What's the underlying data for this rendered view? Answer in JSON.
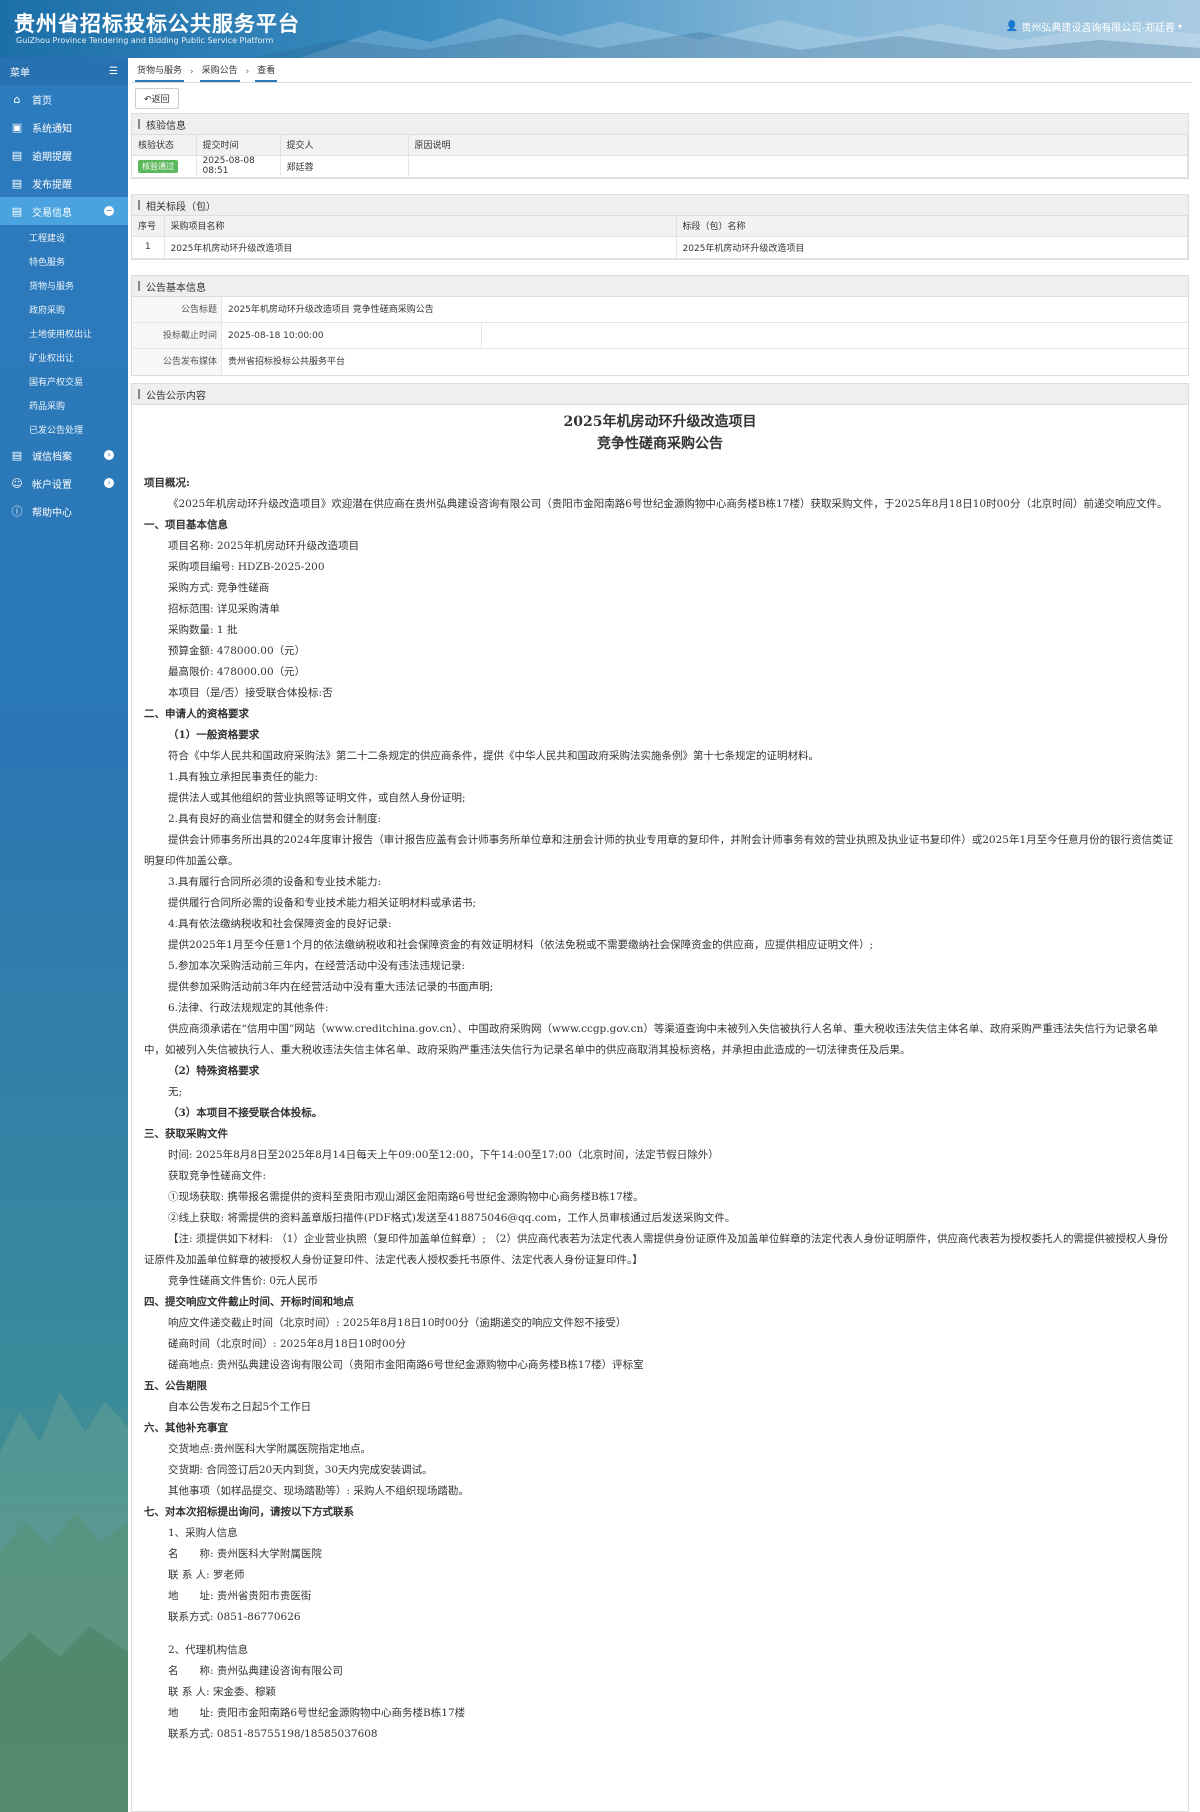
{
  "header": {
    "title": "贵州省招标投标公共服务平台",
    "subtitle": "GuiZhou Province Tendering and Bidding Public Service Platform",
    "user": "贵州弘典建设咨询有限公司-郑廷蓉"
  },
  "sidebar": {
    "menu_label": "菜单",
    "items": [
      {
        "label": "首页",
        "icon": "home-icon"
      },
      {
        "label": "系统通知",
        "icon": "monitor-icon"
      },
      {
        "label": "逾期提醒",
        "icon": "list-icon"
      },
      {
        "label": "发布提醒",
        "icon": "list-icon"
      },
      {
        "label": "交易信息",
        "icon": "list-icon"
      }
    ],
    "sub_items": [
      "工程建设",
      "特色服务",
      "货物与服务",
      "政府采购",
      "土地使用权出让",
      "矿业权出让",
      "国有产权交易",
      "药品采购",
      "已发公告处理"
    ],
    "bottom_items": [
      {
        "label": "诚信档案",
        "icon": "list-icon"
      },
      {
        "label": "帐户设置",
        "icon": "user-icon"
      },
      {
        "label": "帮助中心",
        "icon": "help-icon"
      }
    ]
  },
  "breadcrumb": [
    "货物与服务",
    "采购公告",
    "查看"
  ],
  "back_label": "返回",
  "verify": {
    "title": "核验信息",
    "headers": [
      "核验状态",
      "提交时间",
      "提交人",
      "原因说明"
    ],
    "row": {
      "status": "核验通过",
      "time": "2025-08-08 08:51",
      "person": "郑廷蓉",
      "reason": ""
    }
  },
  "sections": {
    "title": "相关标段（包）",
    "headers": [
      "序号",
      "采购项目名称",
      "标段（包）名称"
    ],
    "row": {
      "no": "1",
      "project": "2025年机房动环升级改造项目",
      "section": "2025年机房动环升级改造项目"
    }
  },
  "basic": {
    "title": "公告基本信息",
    "rows": [
      {
        "label": "公告标题",
        "value": "2025年机房动环升级改造项目 竞争性磋商采购公告"
      },
      {
        "label": "投标截止时间",
        "value": "2025-08-18 10:00:00"
      },
      {
        "label": "公告发布媒体",
        "value": "贵州省招标投标公共服务平台"
      }
    ]
  },
  "content": {
    "title": "公告公示内容",
    "doc_title1": "2025年机房动环升级改造项目",
    "doc_title2": "竞争性磋商采购公告",
    "lines": [
      {
        "t": "项目概况:",
        "c": "sec i0"
      },
      {
        "t": "《2025年机房动环升级改造项目》欢迎潜在供应商在贵州弘典建设咨询有限公司（贵阳市金阳南路6号世纪金源购物中心商务楼B栋17楼）获取采购文件，于2025年8月18日10时00分（北京时间）前递交响应文件。",
        "c": "ind"
      },
      {
        "t": "一、项目基本信息",
        "c": "sec"
      },
      {
        "t": "项目名称: 2025年机房动环升级改造项目",
        "c": "i1"
      },
      {
        "t": "采购项目编号: HDZB-2025-200",
        "c": "i1"
      },
      {
        "t": "采购方式: 竞争性磋商",
        "c": "i1"
      },
      {
        "t": "招标范围: 详见采购清单",
        "c": "i1"
      },
      {
        "t": "采购数量: 1 批",
        "c": "i1"
      },
      {
        "t": "预算金额:  478000.00（元）",
        "c": "i1"
      },
      {
        "t": "最高限价:  478000.00（元）",
        "c": "i1"
      },
      {
        "t": "本项目（是/否）接受联合体投标:否",
        "c": "i1"
      },
      {
        "t": "二、申请人的资格要求",
        "c": "sec"
      },
      {
        "t": "（1）一般资格要求",
        "c": "sec i1"
      },
      {
        "t": "符合《中华人民共和国政府采购法》第二十二条规定的供应商条件，提供《中华人民共和国政府采购法实施条例》第十七条规定的证明材料。",
        "c": "i1"
      },
      {
        "t": "1.具有独立承担民事责任的能力:",
        "c": "i1"
      },
      {
        "t": "提供法人或其他组织的营业执照等证明文件，或自然人身份证明;",
        "c": "i1"
      },
      {
        "t": "2.具有良好的商业信誉和健全的财务会计制度:",
        "c": "i1"
      },
      {
        "t": "提供会计师事务所出具的2024年度审计报告（审计报告应盖有会计师事务所单位章和注册会计师的执业专用章的复印件，并附会计师事务有效的营业执照及执业证书复印件）或2025年1月至今任意月份的银行资信类证明复印件加盖公章。",
        "c": "ind"
      },
      {
        "t": "3.具有履行合同所必须的设备和专业技术能力:",
        "c": "i1"
      },
      {
        "t": "提供履行合同所必需的设备和专业技术能力相关证明材料或承诺书;",
        "c": "i1"
      },
      {
        "t": "4.具有依法缴纳税收和社会保障资金的良好记录:",
        "c": "i1"
      },
      {
        "t": "提供2025年1月至今任意1个月的依法缴纳税收和社会保障资金的有效证明材料（依法免税或不需要缴纳社会保障资金的供应商，应提供相应证明文件）;",
        "c": "i1"
      },
      {
        "t": "5.参加本次采购活动前三年内，在经营活动中没有违法违规记录:",
        "c": "i1"
      },
      {
        "t": "提供参加采购活动前3年内在经营活动中没有重大违法记录的书面声明;",
        "c": "i1"
      },
      {
        "t": "6.法律、行政法规规定的其他条件:",
        "c": "i1"
      },
      {
        "t": "供应商须承诺在“信用中国”网站（www.creditchina.gov.cn）、中国政府采购网（www.ccgp.gov.cn）等渠道查询中未被列入失信被执行人名单、重大税收违法失信主体名单、政府采购严重违法失信行为记录名单中，如被列入失信被执行人、重大税收违法失信主体名单、政府采购严重违法失信行为记录名单中的供应商取消其投标资格，并承担由此造成的一切法律责任及后果。",
        "c": "ind"
      },
      {
        "t": "（2）特殊资格要求",
        "c": "sec i1"
      },
      {
        "t": "无;",
        "c": "i1"
      },
      {
        "t": "（3）本项目不接受联合体投标。",
        "c": "sec i1"
      },
      {
        "t": "三、获取采购文件",
        "c": "sec"
      },
      {
        "t": "时间: 2025年8月8日至2025年8月14日每天上午09:00至12:00，下午14:00至17:00（北京时间，法定节假日除外）",
        "c": "i1"
      },
      {
        "t": "获取竞争性磋商文件:",
        "c": "i1"
      },
      {
        "t": "①现场获取: 携带报名需提供的资料至贵阳市观山湖区金阳南路6号世纪金源购物中心商务楼B栋17楼。",
        "c": "i1"
      },
      {
        "t": "②线上获取: 将需提供的资料盖章版扫描件(PDF格式)发送至418875046@qq.com，工作人员审核通过后发送采购文件。",
        "c": "i1"
      },
      {
        "t": "【注: 须提供如下材料: （1）企业营业执照（复印件加盖单位鲜章）; （2）供应商代表若为法定代表人需提供身份证原件及加盖单位鲜章的法定代表人身份证明原件，供应商代表若为授权委托人的需提供被授权人身份证原件及加盖单位鲜章的被授权人身份证复印件、法定代表人授权委托书原件、法定代表人身份证复印件。】",
        "c": "ind"
      },
      {
        "t": "竞争性磋商文件售价: 0元人民币",
        "c": "i1"
      },
      {
        "t": "四、提交响应文件截止时间、开标时间和地点",
        "c": "sec"
      },
      {
        "t": "响应文件递交截止时间（北京时间）: 2025年8月18日10时00分（逾期递交的响应文件恕不接受）",
        "c": "i1"
      },
      {
        "t": "磋商时间（北京时间）: 2025年8月18日10时00分",
        "c": "i1"
      },
      {
        "t": "磋商地点: 贵州弘典建设咨询有限公司（贵阳市金阳南路6号世纪金源购物中心商务楼B栋17楼）评标室",
        "c": "i1"
      },
      {
        "t": "五、公告期限",
        "c": "sec"
      },
      {
        "t": "自本公告发布之日起5个工作日",
        "c": "i1"
      },
      {
        "t": "六、其他补充事宜",
        "c": "sec"
      },
      {
        "t": "交货地点:贵州医科大学附属医院指定地点。",
        "c": "i1"
      },
      {
        "t": "交货期: 合同签订后20天内到货，30天内完成安装调试。",
        "c": "i1"
      },
      {
        "t": "其他事项（如样品提交、现场踏勘等）: 采购人不组织现场踏勘。",
        "c": "i1"
      },
      {
        "t": "七、对本次招标提出询问，请按以下方式联系",
        "c": "sec"
      },
      {
        "t": "1、采购人信息",
        "c": "i1"
      },
      {
        "t": "名　　称: 贵州医科大学附属医院",
        "c": "i1"
      },
      {
        "t": "联 系 人: 罗老师",
        "c": "i1"
      },
      {
        "t": "地　　址: 贵州省贵阳市贵医街",
        "c": "i1"
      },
      {
        "t": "联系方式: 0851-86770626",
        "c": "i1"
      },
      {
        "t": "",
        "c": "gap"
      },
      {
        "t": "2、代理机构信息",
        "c": "i1"
      },
      {
        "t": "名　　称: 贵州弘典建设咨询有限公司",
        "c": "i1"
      },
      {
        "t": "联 系 人: 宋金委、穆颖",
        "c": "i1"
      },
      {
        "t": "地　　址: 贵阳市金阳南路6号世纪金源购物中心商务楼B栋17楼",
        "c": "i1"
      },
      {
        "t": "联系方式: 0851-85755198/18585037608",
        "c": "i1"
      }
    ]
  }
}
